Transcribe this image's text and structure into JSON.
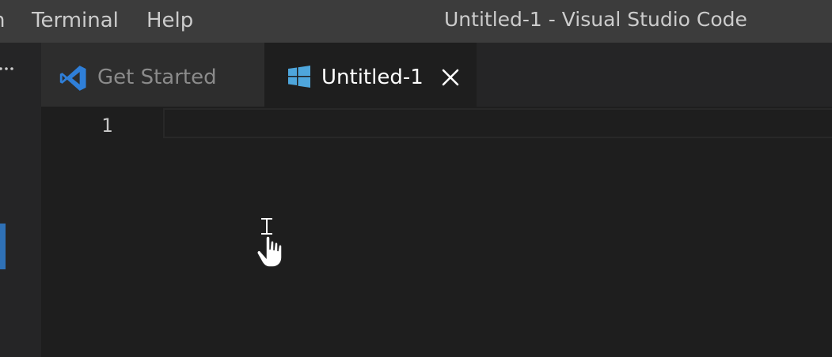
{
  "menubar": {
    "partial_label": "n",
    "items": [
      {
        "label": "Terminal"
      },
      {
        "label": "Help"
      }
    ]
  },
  "window": {
    "title": "Untitled-1 - Visual Studio Code"
  },
  "sidebar": {
    "more_icon": "ellipsis-icon",
    "active_indicator_color": "#2f71b6"
  },
  "tabs": [
    {
      "label": "Get Started",
      "icon": "vscode-logo-icon",
      "active": false
    },
    {
      "label": "Untitled-1",
      "icon": "windows-logo-icon",
      "active": true,
      "close_icon": "close-icon"
    }
  ],
  "editor": {
    "line_numbers": [
      "1"
    ],
    "content": [
      ""
    ]
  },
  "colors": {
    "titlebar_bg": "#3c3c3c",
    "editor_bg": "#1e1e1e",
    "tab_inactive_bg": "#2d2d2d",
    "vscode_blue": "#2f7fd8"
  },
  "cursor": {
    "icon": "hand-pointer-icon"
  }
}
